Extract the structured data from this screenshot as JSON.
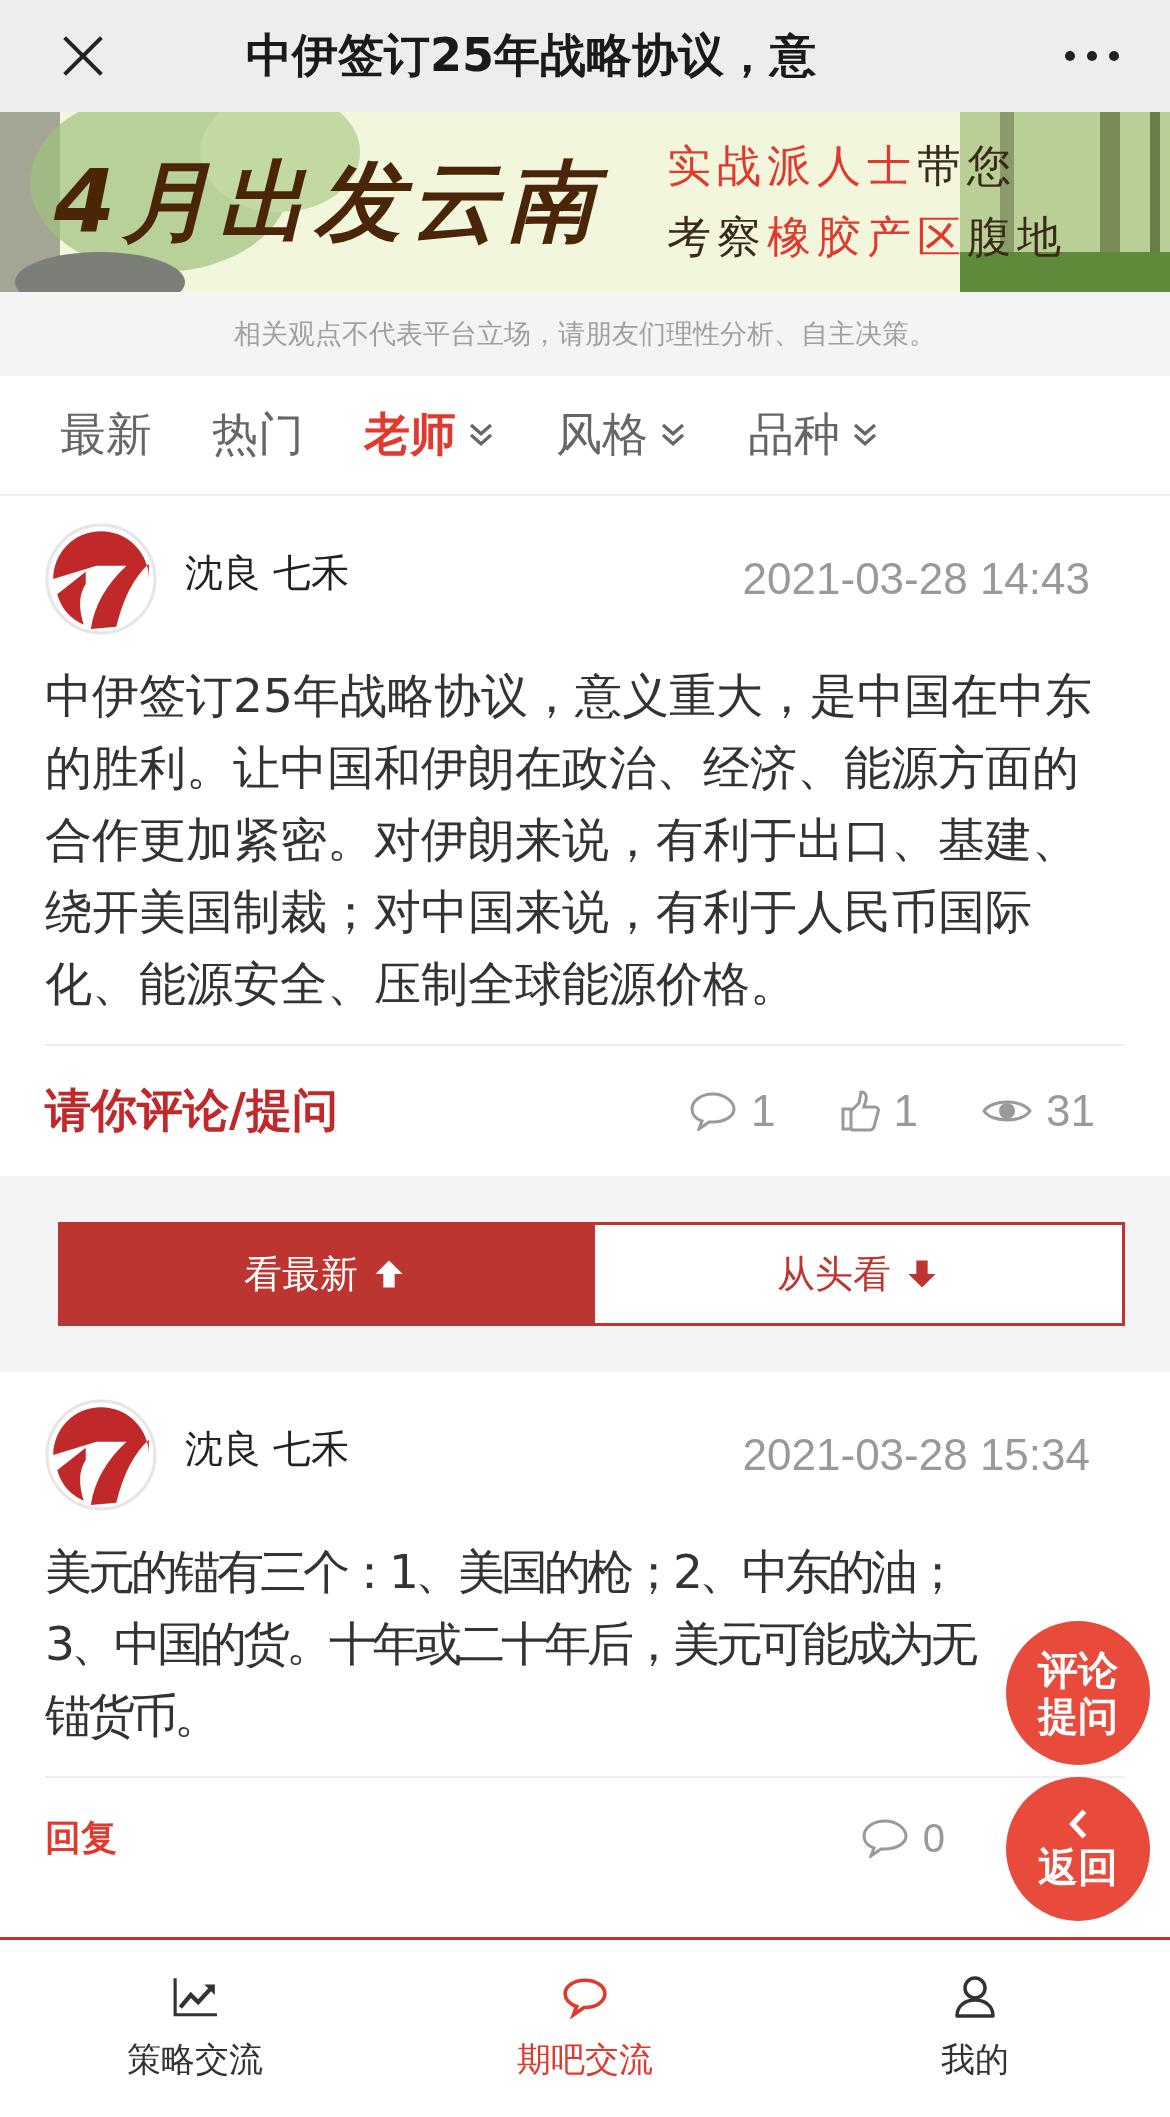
{
  "header": {
    "title": "中伊签订25年战略协议，意"
  },
  "banner": {
    "kind": "picture",
    "headline": "4月出发云南",
    "line_1": [
      {
        "text": "实战派人士",
        "highlight": true
      },
      {
        "text": "带您",
        "highlight": false
      }
    ],
    "line_2": [
      {
        "text": "考察",
        "highlight": false
      },
      {
        "text": "橡胶产区",
        "highlight": true
      },
      {
        "text": "腹地",
        "highlight": false
      }
    ]
  },
  "disclaimer": "相关观点不代表平台立场，请朋友们理性分析、自主决策。",
  "tabs": [
    {
      "label": "最新",
      "selected": false,
      "kind": "plain"
    },
    {
      "label": "热门",
      "selected": false,
      "kind": "plain"
    },
    {
      "label": "老师",
      "selected": true,
      "kind": "dropdown"
    },
    {
      "label": "风格",
      "selected": false,
      "kind": "dropdown"
    },
    {
      "label": "品种",
      "selected": false,
      "kind": "dropdown"
    }
  ],
  "posts": [
    {
      "author": "沈良 七禾",
      "time": "2021-03-28 14:43",
      "body": "中伊签订25年战略协议，意义重大，是中国在中东的胜利。让中国和伊朗在政治、经济、能源方面的合作更加紧密。对伊朗来说，有利于出口、基建、绕开美国制裁；对中国来说，有利于人民币国际化、能源安全、压制全球能源价格。",
      "action": "请你评论/提问",
      "kind": "full",
      "comments": "1",
      "likes": "1",
      "views": "31"
    },
    {
      "author": "沈良 七禾",
      "time": "2021-03-28 15:34",
      "body": "美元的锚有三个：1、美国的枪；2、中东的油；3、中国的货。十年或二十年后，美元可能成为无锚货币。",
      "action": "回复",
      "kind": "reply",
      "comments": "0"
    }
  ],
  "sort_buttons": [
    {
      "label": "看最新",
      "selected": true,
      "kind": "up"
    },
    {
      "label": "从头看",
      "selected": false,
      "kind": "down"
    }
  ],
  "floating_buttons": [
    {
      "label": "评论提问",
      "kind": "text"
    },
    {
      "label": "返回",
      "kind": "back"
    }
  ],
  "bottom_nav": [
    {
      "label": "策略交流",
      "selected": false,
      "kind": "chart"
    },
    {
      "label": "期吧交流",
      "selected": true,
      "kind": "chat"
    },
    {
      "label": "我的",
      "selected": false,
      "kind": "user"
    }
  ]
}
